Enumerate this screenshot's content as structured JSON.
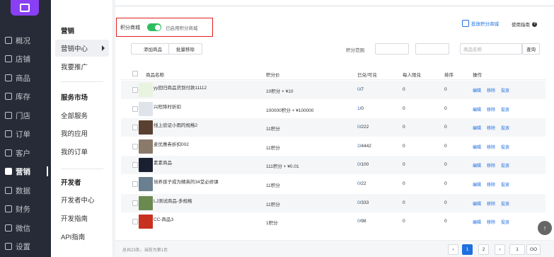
{
  "rail": {
    "items": [
      {
        "label": "概况",
        "icon": "overview-icon"
      },
      {
        "label": "店铺",
        "icon": "store-icon"
      },
      {
        "label": "商品",
        "icon": "goods-icon"
      },
      {
        "label": "库存",
        "icon": "inventory-icon"
      },
      {
        "label": "门店",
        "icon": "shop-icon"
      },
      {
        "label": "订单",
        "icon": "order-icon"
      },
      {
        "label": "客户",
        "icon": "customer-icon"
      },
      {
        "label": "营销",
        "icon": "marketing-icon"
      },
      {
        "label": "数据",
        "icon": "data-icon"
      },
      {
        "label": "财务",
        "icon": "finance-icon"
      },
      {
        "label": "微信",
        "icon": "wechat-icon"
      },
      {
        "label": "设置",
        "icon": "settings-icon"
      }
    ]
  },
  "sidebar": {
    "marketing_title": "营销",
    "marketing_center": "营销中心",
    "promote": "我要推广",
    "service_title": "服务市场",
    "all_services": "全部服务",
    "my_apps": "我的应用",
    "my_orders": "我的订单",
    "dev_title": "开发者",
    "dev_center": "开发者中心",
    "dev_guide": "开发指南",
    "api_guide": "API指南"
  },
  "mall": {
    "label": "积分商城",
    "toggle_state": "已启用积分商城",
    "promo_link": "投放积分商城",
    "guide_link": "使用指南"
  },
  "toolbar": {
    "add_label": "添加商品",
    "batch_remove_label": "批量移除",
    "range_label": "积分范围",
    "range_sep": "-",
    "search_placeholder": "商品名称",
    "search_label": "查询"
  },
  "table": {
    "headers": {
      "name": "商品名称",
      "price": "积分价",
      "exchanged": "已兑/可兑",
      "limit": "每人限兑",
      "sort": "排序",
      "ops": "操作"
    },
    "op_labels": {
      "edit": "编辑",
      "remove": "移除",
      "place": "投放"
    },
    "rows": [
      {
        "name": "yy回归商品货到付款11112",
        "price": "10积分 + ¥10",
        "done": "0",
        "total": "/7",
        "limit": "0",
        "sort": "0"
      },
      {
        "name": "兴旺降时折扣",
        "price": "100000积分 + ¥100000",
        "done": "1",
        "total": "/0",
        "limit": "0",
        "sort": "0"
      },
      {
        "name": "线上验证小雨的规格2",
        "price": "11积分",
        "done": "0",
        "total": "/222",
        "limit": "0",
        "sort": "0"
      },
      {
        "name": "麦优惠券折扣002",
        "price": "11积分",
        "done": "2",
        "total": "/4442",
        "limit": "0",
        "sort": "0"
      },
      {
        "name": "素素商品",
        "price": "111积分 + ¥0.01",
        "done": "0",
        "total": "/100",
        "limit": "0",
        "sort": "0"
      },
      {
        "name": "培养孩子成为精英的34堂必修课",
        "price": "11积分",
        "done": "0",
        "total": "/22",
        "limit": "0",
        "sort": "0"
      },
      {
        "name": "LJ测试商品-多规格",
        "price": "11积分",
        "done": "0",
        "total": "/333",
        "limit": "0",
        "sort": "0"
      },
      {
        "name": "CC-商品3",
        "price": "1积分",
        "done": "0",
        "total": "/98",
        "limit": "0",
        "sort": "0"
      }
    ]
  },
  "footer": {
    "summary": "总共23条，当前为第1页",
    "prev": "‹",
    "page1": "1",
    "page2": "2",
    "next": "›",
    "jump_value": "1",
    "go": "GO"
  },
  "colors": {
    "accent": "#1f6fe0",
    "toggle_on": "#2dbe60",
    "highlight_border": "#e02020",
    "rail_bg": "#262b37"
  }
}
